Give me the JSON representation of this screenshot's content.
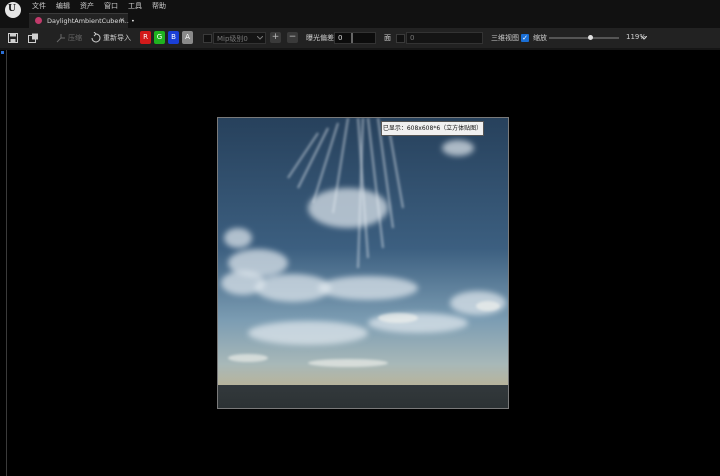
{
  "menu": {
    "items": [
      "文件",
      "编辑",
      "资产",
      "窗口",
      "工具",
      "帮助"
    ]
  },
  "tab": {
    "title": "DaylightAmbientCubem..",
    "modified_marker": "•",
    "close_glyph": "×"
  },
  "toolbar": {
    "compress_label": "压缩",
    "reimport_label": "重新导入",
    "channels": [
      {
        "label": "R",
        "color": "#d21a1a"
      },
      {
        "label": "G",
        "color": "#1fb31f"
      },
      {
        "label": "B",
        "color": "#1a3fd6"
      },
      {
        "label": "A",
        "color": "#8a8a8a"
      }
    ],
    "mip_value": "Mip级别0",
    "plus_glyph": "+",
    "minus_glyph": "−",
    "exposure_label": "曝光偏差",
    "exposure_value": "0",
    "face_label": "面",
    "face_value": "0",
    "view3d_label": "三维视图",
    "zoom_label": "缩放",
    "zoom_checked": true,
    "zoom_value": "119%",
    "zoom_slider_fraction": 0.59
  },
  "viewport": {
    "tooltip": "已显示：608x608*6（立方体贴图）"
  },
  "colors": {
    "accent": "#1a6fd6",
    "tab_icon": "#c23a6b"
  }
}
